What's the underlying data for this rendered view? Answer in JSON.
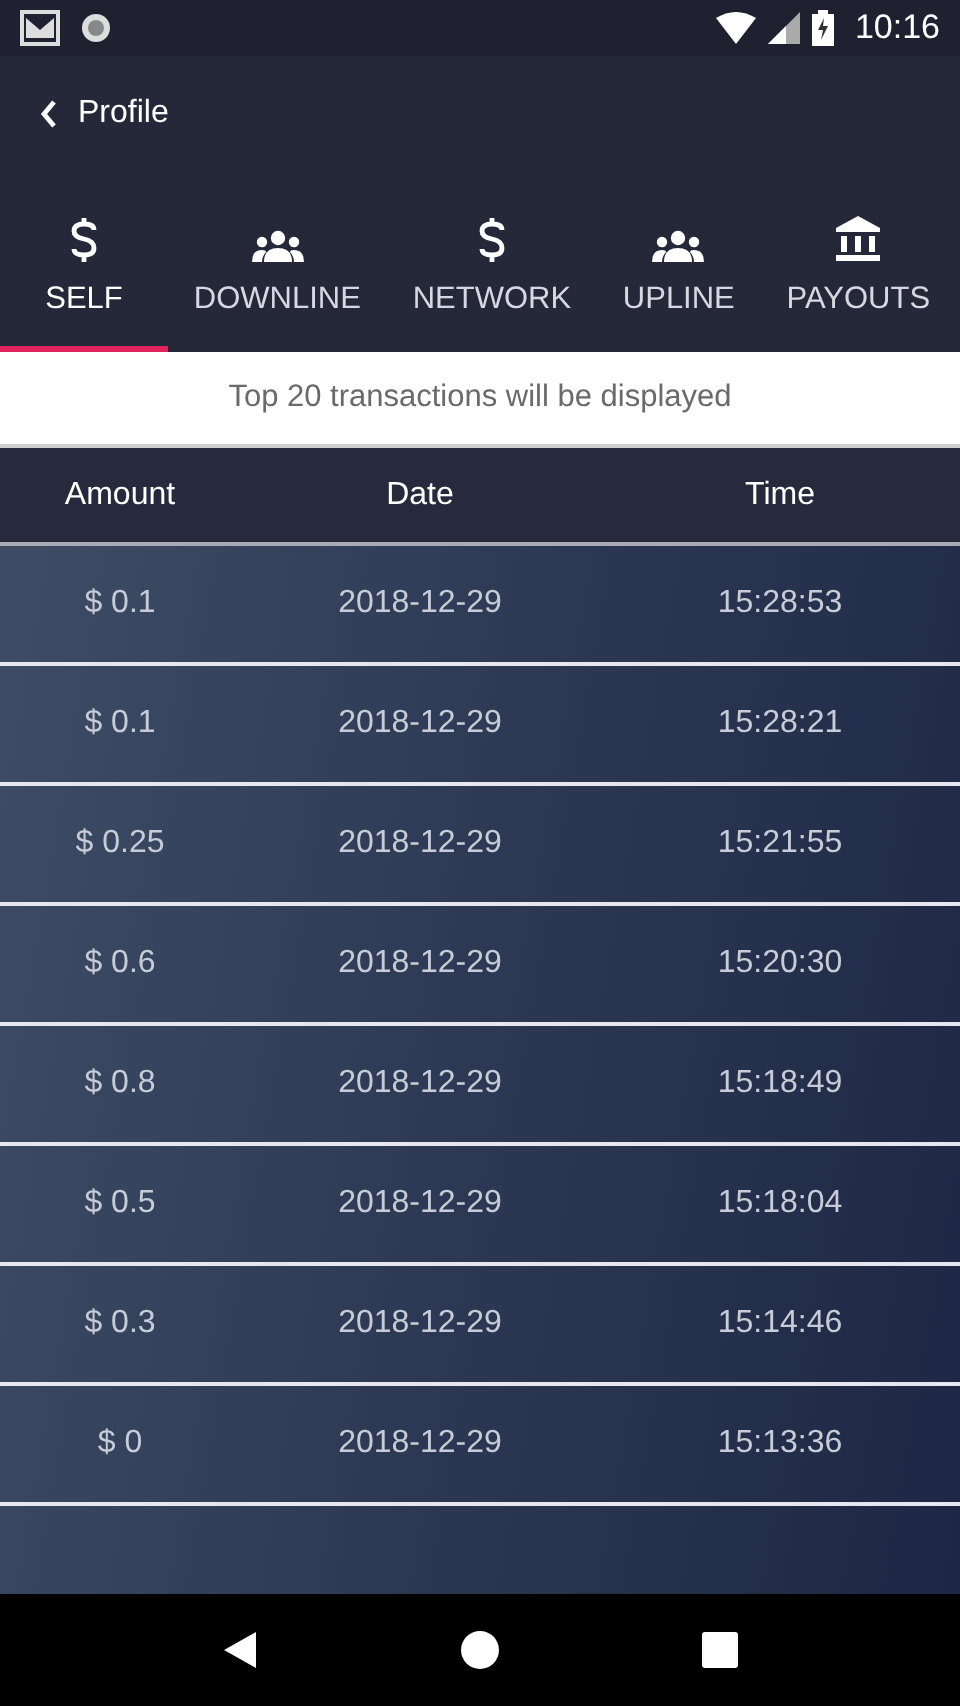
{
  "status_bar": {
    "time": "10:16"
  },
  "back": {
    "label": "Profile"
  },
  "tabs": [
    {
      "label": "SELF",
      "kind": "dollar",
      "selected": true
    },
    {
      "label": "DOWNLINE",
      "kind": "people",
      "selected": false
    },
    {
      "label": "NETWORK",
      "kind": "dollar",
      "selected": false
    },
    {
      "label": "UPLINE",
      "kind": "people",
      "selected": false
    },
    {
      "label": "PAYOUTS",
      "kind": "bank",
      "selected": false
    }
  ],
  "notice": "Top 20 transactions will be displayed",
  "table": {
    "columns": [
      "Amount",
      "Date",
      "Time"
    ],
    "rows": [
      [
        "$ 0.1",
        "2018-12-29",
        "15:28:53"
      ],
      [
        "$ 0.1",
        "2018-12-29",
        "15:28:21"
      ],
      [
        "$ 0.25",
        "2018-12-29",
        "15:21:55"
      ],
      [
        "$ 0.6",
        "2018-12-29",
        "15:20:30"
      ],
      [
        "$ 0.8",
        "2018-12-29",
        "15:18:49"
      ],
      [
        "$ 0.5",
        "2018-12-29",
        "15:18:04"
      ],
      [
        "$ 0.3",
        "2018-12-29",
        "15:14:46"
      ],
      [
        "$ 0",
        "2018-12-29",
        "15:13:36"
      ]
    ]
  }
}
